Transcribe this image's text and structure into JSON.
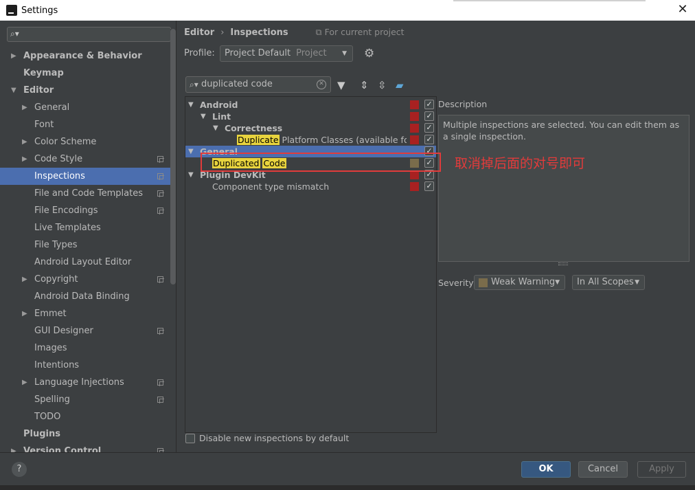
{
  "window": {
    "title": "Settings"
  },
  "sidebar": {
    "search_value": "",
    "items": [
      {
        "label": "Appearance & Behavior",
        "level": 0,
        "expander": "collapsed",
        "bold": true,
        "project": false,
        "selected": false
      },
      {
        "label": "Keymap",
        "level": 0,
        "expander": "none",
        "bold": true,
        "project": false,
        "selected": false
      },
      {
        "label": "Editor",
        "level": 0,
        "expander": "expanded",
        "bold": true,
        "project": false,
        "selected": false
      },
      {
        "label": "General",
        "level": 1,
        "expander": "collapsed",
        "bold": false,
        "project": false,
        "selected": false
      },
      {
        "label": "Font",
        "level": 1,
        "expander": "none",
        "bold": false,
        "project": false,
        "selected": false
      },
      {
        "label": "Color Scheme",
        "level": 1,
        "expander": "collapsed",
        "bold": false,
        "project": false,
        "selected": false
      },
      {
        "label": "Code Style",
        "level": 1,
        "expander": "collapsed",
        "bold": false,
        "project": true,
        "selected": false
      },
      {
        "label": "Inspections",
        "level": 1,
        "expander": "none",
        "bold": false,
        "project": true,
        "selected": true
      },
      {
        "label": "File and Code Templates",
        "level": 1,
        "expander": "none",
        "bold": false,
        "project": true,
        "selected": false
      },
      {
        "label": "File Encodings",
        "level": 1,
        "expander": "none",
        "bold": false,
        "project": true,
        "selected": false
      },
      {
        "label": "Live Templates",
        "level": 1,
        "expander": "none",
        "bold": false,
        "project": false,
        "selected": false
      },
      {
        "label": "File Types",
        "level": 1,
        "expander": "none",
        "bold": false,
        "project": false,
        "selected": false
      },
      {
        "label": "Android Layout Editor",
        "level": 1,
        "expander": "none",
        "bold": false,
        "project": false,
        "selected": false
      },
      {
        "label": "Copyright",
        "level": 1,
        "expander": "collapsed",
        "bold": false,
        "project": true,
        "selected": false
      },
      {
        "label": "Android Data Binding",
        "level": 1,
        "expander": "none",
        "bold": false,
        "project": false,
        "selected": false
      },
      {
        "label": "Emmet",
        "level": 1,
        "expander": "collapsed",
        "bold": false,
        "project": false,
        "selected": false
      },
      {
        "label": "GUI Designer",
        "level": 1,
        "expander": "none",
        "bold": false,
        "project": true,
        "selected": false
      },
      {
        "label": "Images",
        "level": 1,
        "expander": "none",
        "bold": false,
        "project": false,
        "selected": false
      },
      {
        "label": "Intentions",
        "level": 1,
        "expander": "none",
        "bold": false,
        "project": false,
        "selected": false
      },
      {
        "label": "Language Injections",
        "level": 1,
        "expander": "collapsed",
        "bold": false,
        "project": true,
        "selected": false
      },
      {
        "label": "Spelling",
        "level": 1,
        "expander": "none",
        "bold": false,
        "project": true,
        "selected": false
      },
      {
        "label": "TODO",
        "level": 1,
        "expander": "none",
        "bold": false,
        "project": false,
        "selected": false
      },
      {
        "label": "Plugins",
        "level": 0,
        "expander": "none",
        "bold": true,
        "project": false,
        "selected": false
      },
      {
        "label": "Version Control",
        "level": 0,
        "expander": "collapsed",
        "bold": true,
        "project": true,
        "selected": false
      }
    ]
  },
  "breadcrumb": {
    "parent": "Editor",
    "current": "Inspections",
    "scope": "For current project"
  },
  "profile": {
    "label": "Profile:",
    "value": "Project Default",
    "secondary": "Project"
  },
  "filter": {
    "value": "duplicated code"
  },
  "inspections": [
    {
      "level": 0,
      "expander": "expanded",
      "bold": true,
      "parts": [
        {
          "text": "Android",
          "hl": false
        }
      ],
      "severity": "error",
      "checked": true,
      "selected": false
    },
    {
      "level": 1,
      "expander": "expanded",
      "bold": true,
      "parts": [
        {
          "text": "Lint",
          "hl": false
        }
      ],
      "severity": "error",
      "checked": true,
      "selected": false
    },
    {
      "level": 2,
      "expander": "expanded",
      "bold": true,
      "parts": [
        {
          "text": "Correctness",
          "hl": false
        }
      ],
      "severity": "error",
      "checked": true,
      "selected": false
    },
    {
      "level": 3,
      "expander": "none",
      "bold": false,
      "parts": [
        {
          "text": "Duplicate",
          "hl": true
        },
        {
          "text": " Platform Classes (available for Ar",
          "hl": false
        }
      ],
      "severity": "error",
      "checked": true,
      "selected": false
    },
    {
      "level": 0,
      "expander": "expanded",
      "bold": true,
      "parts": [
        {
          "text": "General",
          "hl": false
        }
      ],
      "severity": "none",
      "checked": true,
      "selected": true
    },
    {
      "level": 1,
      "expander": "none",
      "bold": false,
      "parts": [
        {
          "text": "Duplicated",
          "hl": true
        },
        {
          "text": " ",
          "hl": false
        },
        {
          "text": "Code",
          "hl": true
        }
      ],
      "severity": "warning",
      "checked": true,
      "selected": false
    },
    {
      "level": 0,
      "expander": "expanded",
      "bold": true,
      "parts": [
        {
          "text": "Plugin DevKit",
          "hl": false
        }
      ],
      "severity": "error",
      "checked": true,
      "selected": false
    },
    {
      "level": 1,
      "expander": "none",
      "bold": false,
      "parts": [
        {
          "text": "Component type mismatch",
          "hl": false
        }
      ],
      "severity": "error",
      "checked": true,
      "selected": false
    }
  ],
  "annotation": "取消掉后面的对号即可",
  "description": {
    "label": "Description",
    "text": "Multiple inspections are selected. You can edit them as a single inspection."
  },
  "severity": {
    "label": "Severity:",
    "value": "Weak Warning",
    "scope": "In All Scopes"
  },
  "disable_new": {
    "label": "Disable new inspections by default",
    "checked": false
  },
  "buttons": {
    "ok": "OK",
    "cancel": "Cancel",
    "apply": "Apply",
    "help": "?"
  },
  "colors": {
    "error": "#a82121",
    "weak_warning": "#7a6c4b",
    "selection": "#4b6eaf",
    "highlight": "#e8d43e",
    "annotation": "#e23b3b"
  }
}
